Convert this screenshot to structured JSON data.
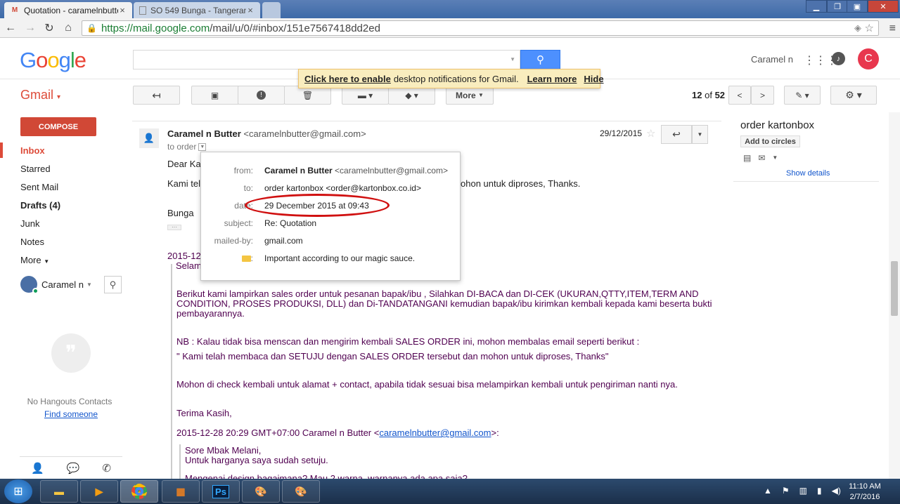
{
  "browser": {
    "tabs": [
      {
        "title": "Quotation - caramelnbutte",
        "favicon": "gmail-icon"
      },
      {
        "title": "SO 549 Bunga - Tangeran",
        "favicon": "page-icon"
      }
    ],
    "url_secure": "https://mail.google.com",
    "url_rest": "/mail/u/0/#inbox/151e7567418dd2ed"
  },
  "header": {
    "user_name": "Caramel n",
    "avatar_letter": "C"
  },
  "notification": {
    "enable_link": "Click here to enable",
    "text": "desktop notifications for Gmail.",
    "learn_more": "Learn more",
    "hide": "Hide"
  },
  "actions": {
    "gmail_label": "Gmail",
    "more_label": "More",
    "pager_current": "12",
    "pager_of": "of",
    "pager_total": "52"
  },
  "nav": {
    "compose": "COMPOSE",
    "items": [
      "Inbox",
      "Starred",
      "Sent Mail",
      "Drafts (4)",
      "Junk",
      "Notes",
      "More"
    ]
  },
  "hangouts": {
    "user": "Caramel n",
    "empty": "No Hangouts Contacts",
    "find": "Find someone"
  },
  "message": {
    "sender_name": "Caramel n Butter",
    "sender_email": "<caramelnbutter@gmail.com>",
    "to": "to order",
    "date": "29/12/2015",
    "greeting": "Dear Ka",
    "line1": "Kami tel",
    "line1_end": "ohon untuk diproses, Thanks.",
    "signoff": "Bunga",
    "quote_date": "2015-12-",
    "quote_greeting": "Selam",
    "para1_a": "Berikut kami lampirkan sales order untuk pesanan bapak/ibu , Silahkan DI-BACA dan DI-CEK (UKURAN,QTTY,ITEM,TERM AND",
    "para1_b": "CONDITION, PROSES PRODUKSI, DLL) dan Di-TANDATANGANI kemudian bapak/ibu kirimkan kembali kepada kami beserta bukti",
    "para1_c": "pembayarannya.",
    "para2": "NB : Kalau tidak bisa menscan dan mengirim kembali SALES ORDER ini, mohon membalas email seperti berikut :",
    "para3": "\" Kami telah membaca dan SETUJU dengan SALES ORDER tersebut dan mohon untuk diproses, Thanks\"",
    "para4": "Mohon di check kembali untuk alamat + contact, apabila tidak sesuai bisa melampirkan kembali untuk pengiriman nanti nya.",
    "thanks": "Terima Kasih,",
    "quote2_prefix": "2015-12-28 20:29 GMT+07:00 Caramel n Butter <",
    "quote2_email": "caramelnbutter@gmail.com",
    "quote2_suffix": ">:",
    "q2_line1": "Sore Mbak Melani,",
    "q2_line2": "Untuk harganya saya sudah setuju.",
    "q2_line3": "Mengenai design bagaimana? Mau 2 warna, warnanya ada apa saja?"
  },
  "details": {
    "from_key": "from:",
    "from_name": "Caramel n Butter",
    "from_email": "<caramelnbutter@gmail.com>",
    "to_key": "to:",
    "to_val": "order kartonbox <order@kartonbox.co.id>",
    "date_key": "date:",
    "date_val": "29 December 2015 at 09:43",
    "subject_key": "subject:",
    "subject_val": "Re: Quotation",
    "mailedby_key": "mailed-by:",
    "mailedby_val": "gmail.com",
    "important_key": ":",
    "important_val": "Important according to our magic sauce."
  },
  "sidebar": {
    "contact": "order kartonbox",
    "add_circles": "Add to circles",
    "show_details": "Show details"
  },
  "taskbar": {
    "time": "11:10 AM",
    "date": "2/7/2016",
    "ps_label": "Ps"
  },
  "colors": {
    "gmail_red": "#dd4b39",
    "search_blue": "#4d90fe",
    "ellipse_red": "#d01010"
  }
}
